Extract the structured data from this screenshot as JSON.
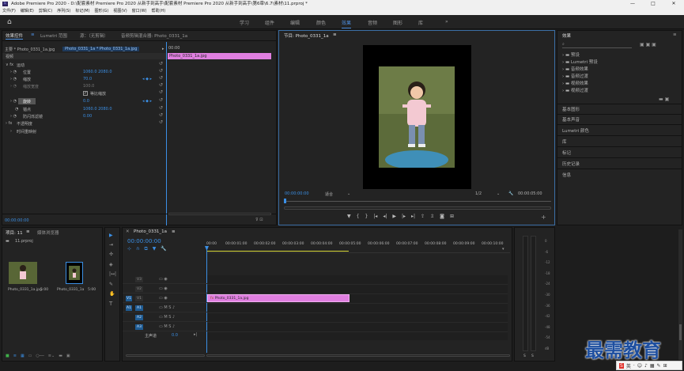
{
  "titlebar": {
    "text": "Adobe Premiere Pro 2020 - D:\\配套素材 Premiere Pro 2020 从新手到高手\\配套素材 Premiere Pro 2020 从新手到高手\\第6章\\6.7\\素材\\11.prproj *",
    "logo": "Pr"
  },
  "window_buttons": [
    "—",
    "□",
    "✕"
  ],
  "menu": [
    "文件(F)",
    "编辑(E)",
    "剪辑(C)",
    "序列(S)",
    "标记(M)",
    "图形(G)",
    "视图(V)",
    "窗口(W)",
    "帮助(H)"
  ],
  "workspaces": [
    "学习",
    "组件",
    "编辑",
    "颜色",
    "效果",
    "音频",
    "图形",
    "库"
  ],
  "workspace_active": "效果",
  "more_icon": "»",
  "effect_controls": {
    "tabs": [
      "效果控件",
      "Lumetri 范围",
      "源：（无剪辑）",
      "音频剪辑混合器: Photo_0331_1a"
    ],
    "tab_menu": "≡",
    "source_clip": "主要 * Photo_0331_1a.jpg",
    "sequence_clip": "Photo_0331_1a * Photo_0331_1a.jpg",
    "section_video": "视频",
    "fx_motion": "运动",
    "params": [
      {
        "name": "位置",
        "value": "1060.0    2080.0"
      },
      {
        "name": "缩放",
        "value": "70.0"
      },
      {
        "name": "缩放宽度",
        "value": "100.0"
      },
      {
        "name": "等比缩放",
        "value": ""
      },
      {
        "name": "旋转",
        "value": "0.0"
      },
      {
        "name": "锚点",
        "value": "1060.0    2080.0"
      },
      {
        "name": "防闪烁滤镜",
        "value": "0.00"
      }
    ],
    "fx_opacity": "不透明度",
    "fx_timeremap": "时间重映射",
    "timecode": "00:00:00:00",
    "mini_clip": "Photo_0331_1a.jpg",
    "mini_time": "00:00"
  },
  "program": {
    "title": "节目: Photo_0331_1a",
    "timecode": "00:00:00:00",
    "fit": "适合",
    "quality": "1/2",
    "duration": "00:00:05:00"
  },
  "effects_panel": {
    "title": "效果",
    "menu": "≡",
    "folders": [
      "预设",
      "Lumetri 预设",
      "音频效果",
      "音频过渡",
      "视频效果",
      "视频过渡"
    ],
    "sections": [
      "基本图形",
      "基本声音",
      "Lumetri 颜色",
      "库",
      "标记",
      "历史记录",
      "信息"
    ]
  },
  "project": {
    "tabs": [
      "项目: 11",
      "媒体浏览器"
    ],
    "file": "11.prproj",
    "items": [
      {
        "name": "Photo_0331_1a.jpg",
        "duration": "5:00"
      },
      {
        "name": "Photo_0331_1a",
        "duration": "5:00"
      }
    ]
  },
  "timeline": {
    "title": "Photo_0331_1a",
    "timecode": "00:00:00:00",
    "ruler": [
      "00:00",
      "00:00:01:00",
      "00:00:02:00",
      "00:00:03:00",
      "00:00:04:00",
      "00:00:05:00",
      "00:00:06:00",
      "00:00:07:00",
      "00:00:08:00",
      "00:00:09:00",
      "00:00:10:00"
    ],
    "tracks": [
      "V3",
      "V2",
      "V1",
      "A1",
      "A2",
      "A3"
    ],
    "master": "主声道",
    "master_value": "0.0",
    "clip": "Photo_0331_1a.jpg",
    "clip_fx": "fx"
  },
  "meter": {
    "labels": [
      "0",
      "-6",
      "-12",
      "-18",
      "-24",
      "-30",
      "-36",
      "-42",
      "-48",
      "-54",
      "dB"
    ],
    "channels": [
      "S",
      "S"
    ]
  },
  "watermark": {
    "text": "最需教育",
    "ime": "英"
  },
  "colors": {
    "accent": "#3b8fe5",
    "clip": "#e07fe0",
    "panel": "#232323"
  }
}
